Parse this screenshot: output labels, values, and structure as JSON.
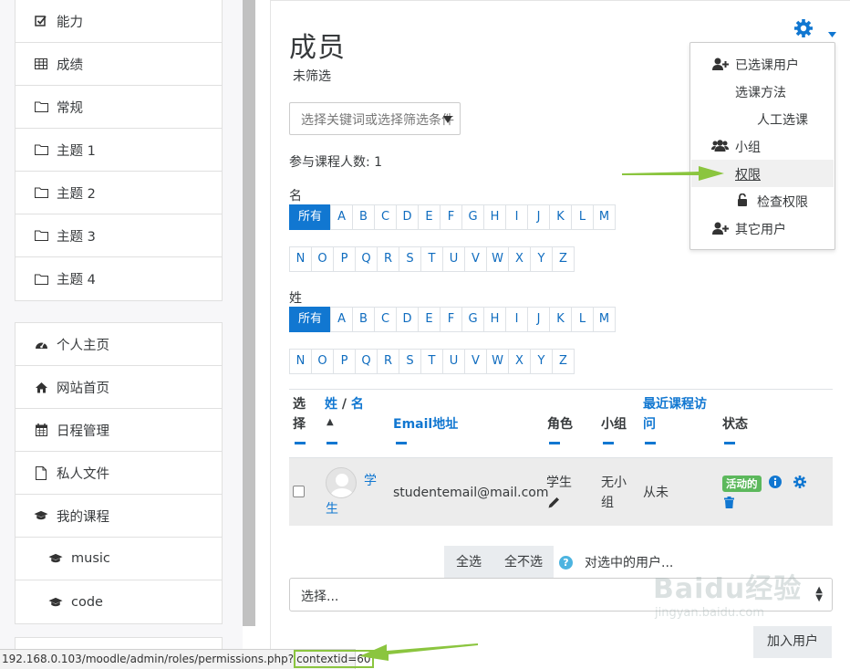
{
  "sidebar": {
    "group1": [
      {
        "label": "能力",
        "icon": "checkbox-icon"
      },
      {
        "label": "成绩",
        "icon": "table-icon"
      },
      {
        "label": "常规",
        "icon": "folder-icon"
      },
      {
        "label": "主题 1",
        "icon": "folder-icon"
      },
      {
        "label": "主题 2",
        "icon": "folder-icon"
      },
      {
        "label": "主题 3",
        "icon": "folder-icon"
      },
      {
        "label": "主题 4",
        "icon": "folder-icon"
      }
    ],
    "group2": [
      {
        "label": "个人主页",
        "icon": "dashboard-icon"
      },
      {
        "label": "网站首页",
        "icon": "home-icon"
      },
      {
        "label": "日程管理",
        "icon": "calendar-icon"
      },
      {
        "label": "私人文件",
        "icon": "file-icon"
      },
      {
        "label": "我的课程",
        "icon": "graduation-cap-icon"
      },
      {
        "label": "music",
        "icon": "graduation-cap-icon"
      },
      {
        "label": "code",
        "icon": "graduation-cap-icon"
      }
    ]
  },
  "main": {
    "title": "成员",
    "no_filter": "未筛选",
    "filter_placeholder": "选择关键词或选择筛选条件",
    "participant_count": "参与课程人数: 1",
    "firstname_label": "名",
    "lastname_label": "姓",
    "initials_row1": [
      "所有",
      "A",
      "B",
      "C",
      "D",
      "E",
      "F",
      "G",
      "H",
      "I",
      "J",
      "K",
      "L",
      "M"
    ],
    "initials_row2": [
      "N",
      "O",
      "P",
      "Q",
      "R",
      "S",
      "T",
      "U",
      "V",
      "W",
      "X",
      "Y",
      "Z"
    ]
  },
  "table": {
    "h_select": "选择",
    "h_last": "姓",
    "h_slash": " / ",
    "h_first": "名",
    "h_sort": "▲",
    "h_email": "Email地址",
    "h_role": "角色",
    "h_group": "小组",
    "h_access": "最近课程访问",
    "h_status": "状态",
    "row": {
      "name_part1": "学",
      "name_part2": "生",
      "email": "studentemail@mail.com",
      "role": "学生",
      "group1": "无小",
      "group2": "组",
      "access": "从未",
      "status": "活动的"
    }
  },
  "bulk": {
    "select_all": "全选",
    "deselect_all": "全不选",
    "with_selected": "对选中的用户...",
    "select_placeholder": "选择...",
    "add_user": "加入用户"
  },
  "dropdown": {
    "items": [
      {
        "label": "已选课用户",
        "icon": "user-plus-icon"
      },
      {
        "label": "选课方法",
        "icon": ""
      },
      {
        "label": "人工选课",
        "icon": ""
      },
      {
        "label": "小组",
        "icon": "users-icon"
      },
      {
        "label": "权限",
        "icon": ""
      },
      {
        "label": "检查权限",
        "icon": "unlock-icon"
      },
      {
        "label": "其它用户",
        "icon": "user-plus-icon"
      }
    ]
  },
  "statusbar": {
    "url_prefix": "192.168.0.103/moodle/admin/roles/permissions.php?",
    "url_param": "contextid=60"
  },
  "watermark": {
    "brand": "Baidu经验",
    "domain": "jingyan.baidu.com"
  },
  "colors": {
    "accent": "#1177d1",
    "active_badge": "#5cb85c",
    "arrow": "#8bc53f"
  }
}
